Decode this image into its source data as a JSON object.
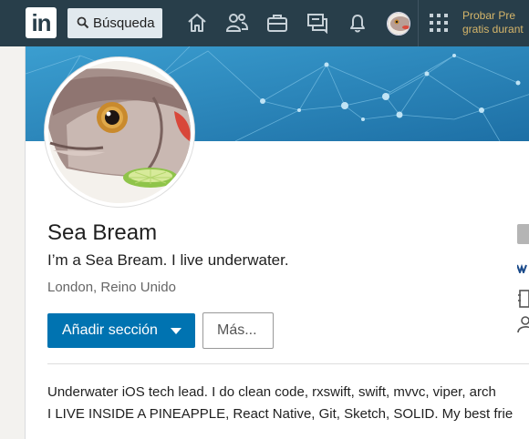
{
  "nav": {
    "logo_text": "in",
    "search_placeholder": "Búsqueda",
    "premium_line1": "Probar Pre",
    "premium_line2": "gratis durant",
    "icons": [
      "home-icon",
      "network-icon",
      "jobs-icon",
      "messaging-icon",
      "notifications-icon",
      "profile-avatar",
      "apps-grid-icon"
    ]
  },
  "profile": {
    "name": "Sea Bream",
    "headline": "I’m a Sea Bream. I live underwater.",
    "location": "London, Reino Unido",
    "add_section_label": "Añadir sección",
    "more_label": "Más...",
    "summary_line1": "Underwater iOS tech lead. I do clean code, rxswift, swift, mvvc, viper, arch",
    "summary_line2": "I LIVE INSIDE A PINEAPPLE, React Native, Git, Sketch, SOLID. My best frie"
  },
  "colors": {
    "nav_bg": "#283e4a",
    "primary": "#0073b1",
    "banner": "#2f8fc3",
    "premium_gold": "#d6b66a"
  }
}
